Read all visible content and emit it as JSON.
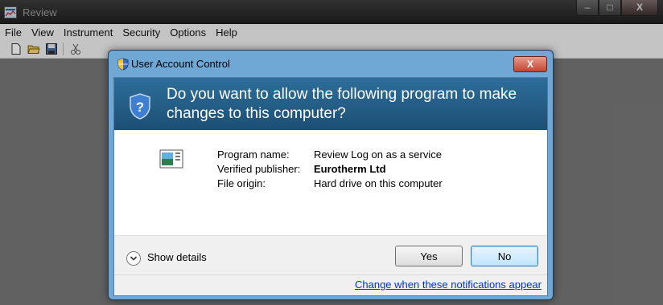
{
  "app": {
    "title": "Review",
    "menu": [
      "File",
      "View",
      "Instrument",
      "Security",
      "Options",
      "Help"
    ],
    "toolbar_icons": [
      "new-file-icon",
      "open-folder-icon",
      "save-icon",
      "cut-icon"
    ]
  },
  "window_controls": {
    "minimize": "–",
    "maximize": "□",
    "close": "X"
  },
  "dialog": {
    "title": "User Account Control",
    "close_glyph": "X",
    "question": "Do you want to allow the following program to make changes to this computer?",
    "fields": [
      {
        "label": "Program name:",
        "value": "Review Log on as a service"
      },
      {
        "label": "Verified publisher:",
        "value": "Eurotherm Ltd"
      },
      {
        "label": "File origin:",
        "value": "Hard drive on this computer"
      }
    ],
    "details_label": "Show details",
    "yes_label": "Yes",
    "no_label": "No",
    "notifications_link": "Change when these notifications appear"
  },
  "colors": {
    "header_blue": "#1d4f74",
    "link_blue": "#0033cc",
    "dialog_frame": "#6fa7d5"
  }
}
